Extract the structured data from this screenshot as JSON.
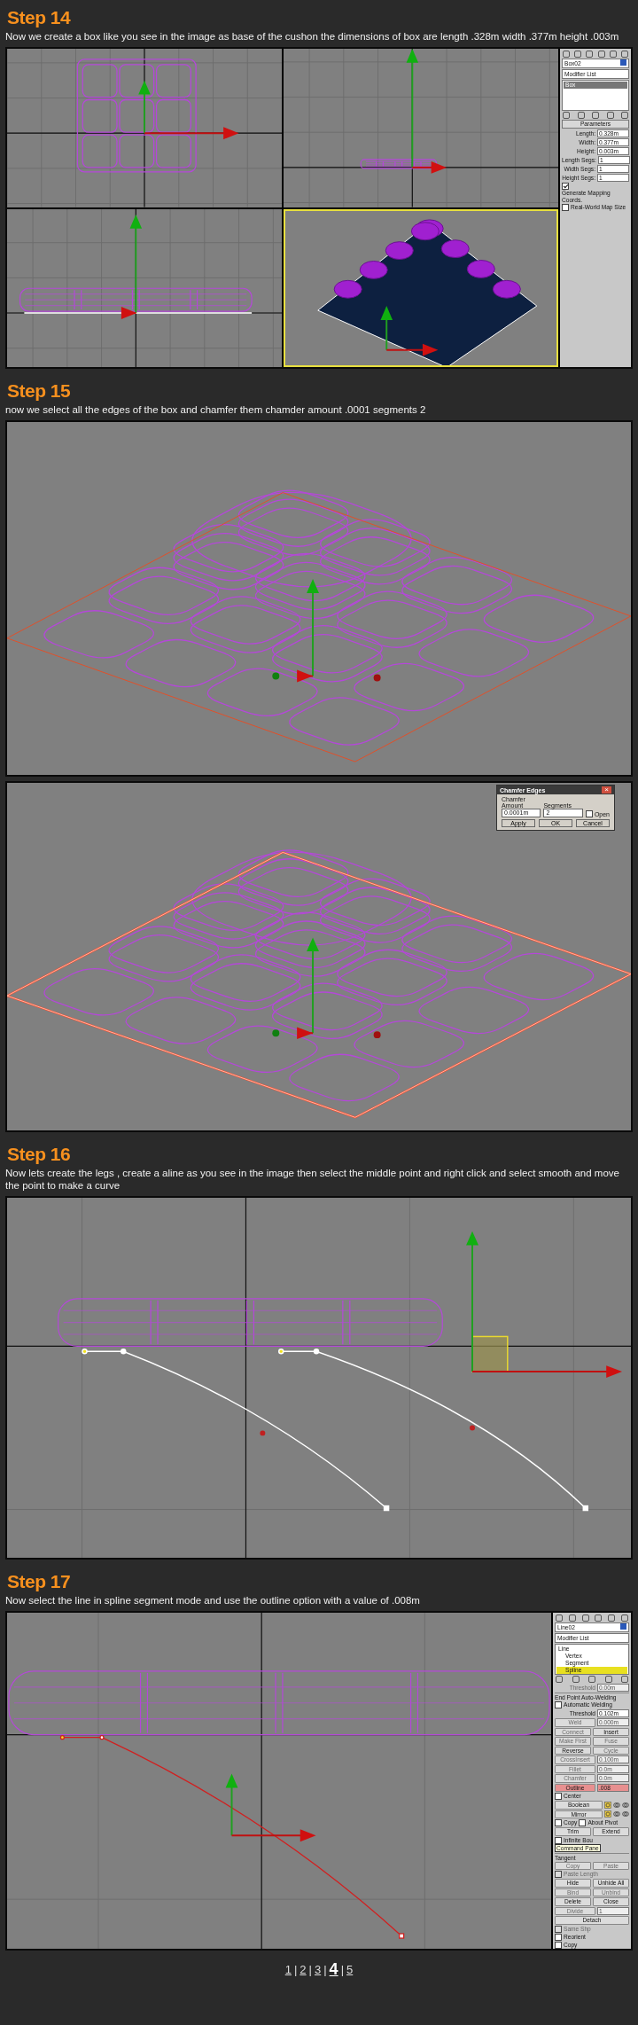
{
  "steps": [
    {
      "title": "Step 14",
      "text": "Now we create a box like you see in the image as base of the cushon the dimensions of box are length .328m width .377m height .003m",
      "figures": [
        {
          "kind": "quad",
          "panel": {
            "name": "Box02",
            "modifier": "Modifier List",
            "stack": [
              {
                "label": "Box",
                "selected": true
              }
            ],
            "rows": [
              {
                "kind": "rollout",
                "label": "Parameters"
              },
              {
                "kind": "field",
                "label": "Length:",
                "value": "0.328m",
                "disabled": false,
                "highlighted": false
              },
              {
                "kind": "field",
                "label": "Width:",
                "value": "0.377m",
                "disabled": false,
                "highlighted": false
              },
              {
                "kind": "field",
                "label": "Height:",
                "value": "0.003m",
                "disabled": false,
                "highlighted": false
              },
              {
                "kind": "field",
                "label": "Length Segs:",
                "value": "1",
                "disabled": false,
                "highlighted": false
              },
              {
                "kind": "field",
                "label": "Width Segs:",
                "value": "1",
                "disabled": false,
                "highlighted": false
              },
              {
                "kind": "field",
                "label": "Height Segs:",
                "value": "1",
                "disabled": false,
                "highlighted": false
              },
              {
                "kind": "check",
                "label": "Generate Mapping Coords.",
                "checked": true,
                "disabled": false
              },
              {
                "kind": "check",
                "label": "Real-World Map Size",
                "checked": false,
                "disabled": false
              }
            ]
          }
        }
      ]
    },
    {
      "title": "Step 15",
      "text": "now we select all the edges of the box and chamfer them chamder amount .0001 segments 2",
      "figures": [
        {
          "kind": "perspective",
          "selected_edges": false
        },
        {
          "kind": "perspective",
          "selected_edges": true,
          "dialog": {
            "title": "Chamfer Edges",
            "close": "×",
            "amount_label": "Chamfer Amount",
            "amount": "0.0001m",
            "segments_label": "Segments",
            "segments": "2",
            "open_label": "Open",
            "open_checked": false,
            "buttons": [
              "Apply",
              "OK",
              "Cancel"
            ]
          }
        }
      ]
    },
    {
      "title": "Step 16",
      "text": "Now lets create the legs , create a aline as you see in the image then select the middle point and right click and select smooth and move the point to make a curve",
      "figures": [
        {
          "kind": "front"
        }
      ]
    },
    {
      "title": "Step 17",
      "text": "Now select the line in spline segment mode and use the outline option with a value of .008m",
      "figures": [
        {
          "kind": "front-panel",
          "panel": {
            "name": "Line02",
            "modifier": "Modifier List",
            "stack": [
              {
                "label": "Line",
                "selected": false,
                "children": [
                  {
                    "label": "Vertex",
                    "selected": false
                  },
                  {
                    "label": "Segment",
                    "selected": false
                  },
                  {
                    "label": "Spline",
                    "selected": true
                  }
                ]
              }
            ],
            "rows": [
              {
                "kind": "field",
                "label": "Threshold",
                "value": "0.00m",
                "disabled": true,
                "highlighted": false
              },
              {
                "kind": "group",
                "label": "End Point Auto-Welding"
              },
              {
                "kind": "check",
                "label": "Automatic Welding",
                "checked": false,
                "disabled": false
              },
              {
                "kind": "field",
                "label": "Threshold",
                "value": "0.102m",
                "disabled": false,
                "highlighted": false
              },
              {
                "kind": "button-field",
                "label": "Weld",
                "value": "0.000m",
                "disabled": true,
                "highlighted": false
              },
              {
                "kind": "buttons",
                "items": [
                  {
                    "label": "Connect",
                    "disabled": true
                  },
                  {
                    "label": "Insert",
                    "disabled": false
                  }
                ]
              },
              {
                "kind": "buttons",
                "items": [
                  {
                    "label": "Make First",
                    "disabled": true
                  },
                  {
                    "label": "Fuse",
                    "disabled": true
                  }
                ]
              },
              {
                "kind": "buttons",
                "items": [
                  {
                    "label": "Reverse",
                    "disabled": false
                  },
                  {
                    "label": "Cycle",
                    "disabled": true
                  }
                ]
              },
              {
                "kind": "button-field",
                "label": "CrossInsert",
                "value": "0.100m",
                "disabled": true,
                "highlighted": false
              },
              {
                "kind": "button-field",
                "label": "Fillet",
                "value": "0.0m",
                "disabled": true,
                "highlighted": false
              },
              {
                "kind": "button-field",
                "label": "Chamfer",
                "value": "0.0m",
                "disabled": true,
                "highlighted": false
              },
              {
                "kind": "button-field",
                "label": "Outline",
                "value": ".008",
                "disabled": false,
                "highlighted": true
              },
              {
                "kind": "check",
                "label": "Center",
                "checked": false,
                "disabled": false
              },
              {
                "kind": "tool",
                "label": "Boolean"
              },
              {
                "kind": "tool",
                "label": "Mirror"
              },
              {
                "kind": "checks",
                "items": [
                  {
                    "label": "Copy",
                    "checked": false
                  },
                  {
                    "label": "About Pivot",
                    "checked": false
                  }
                ]
              },
              {
                "kind": "buttons",
                "items": [
                  {
                    "label": "Trim",
                    "disabled": false
                  },
                  {
                    "label": "Extend",
                    "disabled": false
                  }
                ]
              },
              {
                "kind": "check",
                "label": "Infinite Bou",
                "checked": false,
                "disabled": false,
                "tooltip": "Command Pane"
              },
              {
                "kind": "group",
                "label": "Tangent"
              },
              {
                "kind": "buttons",
                "items": [
                  {
                    "label": "Copy",
                    "disabled": true
                  },
                  {
                    "label": "Paste",
                    "disabled": true
                  }
                ]
              },
              {
                "kind": "check",
                "label": "Paste Length",
                "checked": false,
                "disabled": true
              },
              {
                "kind": "buttons",
                "items": [
                  {
                    "label": "Hide",
                    "disabled": false
                  },
                  {
                    "label": "Unhide All",
                    "disabled": false
                  }
                ]
              },
              {
                "kind": "buttons",
                "items": [
                  {
                    "label": "Bind",
                    "disabled": true
                  },
                  {
                    "label": "Unbind",
                    "disabled": true
                  }
                ]
              },
              {
                "kind": "buttons",
                "items": [
                  {
                    "label": "Delete",
                    "disabled": false
                  },
                  {
                    "label": "Close",
                    "disabled": false
                  }
                ]
              },
              {
                "kind": "button-field",
                "label": "Divide",
                "value": "1",
                "disabled": true,
                "highlighted": false
              },
              {
                "kind": "buttons",
                "items": [
                  {
                    "label": "Detach",
                    "disabled": false
                  }
                ]
              },
              {
                "kind": "check",
                "label": "Same Shp",
                "checked": false,
                "disabled": true
              },
              {
                "kind": "check",
                "label": "Reorient",
                "checked": false,
                "disabled": false
              },
              {
                "kind": "check",
                "label": "Copy",
                "checked": false,
                "disabled": false
              }
            ]
          }
        }
      ]
    }
  ],
  "pagination": [
    {
      "kind": "page",
      "label": "1",
      "selected": false
    },
    {
      "kind": "separator",
      "label": "|"
    },
    {
      "kind": "page",
      "label": "2",
      "selected": false
    },
    {
      "kind": "separator",
      "label": "|"
    },
    {
      "kind": "page",
      "label": "3",
      "selected": false
    },
    {
      "kind": "separator",
      "label": "|"
    },
    {
      "kind": "page",
      "label": "4",
      "selected": true
    },
    {
      "kind": "separator",
      "label": "|"
    },
    {
      "kind": "page",
      "label": "5",
      "selected": false
    }
  ]
}
